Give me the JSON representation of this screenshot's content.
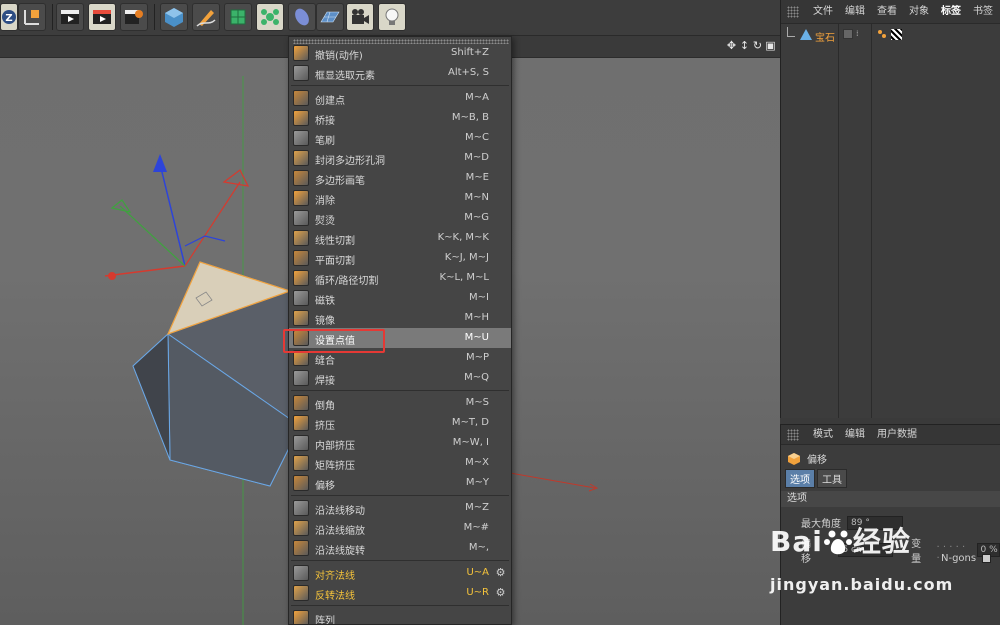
{
  "toolbar": {
    "buttons": [
      {
        "icon": "undo-z-icon"
      },
      {
        "icon": "coordinate-axis-icon"
      },
      {
        "icon": "render-view-icon"
      },
      {
        "icon": "render-picture-viewer-icon"
      },
      {
        "icon": "render-settings-icon"
      },
      {
        "icon": "cube-primitive-icon"
      },
      {
        "icon": "pen-spline-icon"
      },
      {
        "icon": "subdivision-surface-icon"
      },
      {
        "icon": "cloner-array-icon"
      },
      {
        "icon": "deformer-icon"
      },
      {
        "icon": "floor-plane-icon"
      },
      {
        "icon": "camera-icon"
      },
      {
        "icon": "light-bulb-icon"
      }
    ]
  },
  "object_manager": {
    "menu": [
      "文件",
      "编辑",
      "查看",
      "对象",
      "标签",
      "书签"
    ],
    "active_menu": "标签",
    "object_name": "宝石"
  },
  "attribute_manager": {
    "menu": [
      "模式",
      "编辑",
      "用户数据"
    ],
    "title": "偏移",
    "tabs": [
      "选项",
      "工具"
    ],
    "active_tab": "选项",
    "section": "选项",
    "fields": [
      {
        "label": "最大角度",
        "value": "89 °"
      },
      {
        "label": "偏移",
        "value": "5 cm"
      },
      {
        "label": "变量",
        "value": "0 %"
      }
    ],
    "ngons_label": "N-gons"
  },
  "context_menu": {
    "items": [
      {
        "label": "撤销(动作)",
        "shortcut": "Shift+Z",
        "icon": "undo-action-icon"
      },
      {
        "label": "框显选取元素",
        "shortcut": "Alt+S, S",
        "icon": "frame-selected-icon"
      },
      {
        "sep": true
      },
      {
        "label": "创建点",
        "shortcut": "M~A",
        "icon": "create-point-icon"
      },
      {
        "label": "桥接",
        "shortcut": "M~B, B",
        "icon": "bridge-icon"
      },
      {
        "label": "笔刷",
        "shortcut": "M~C",
        "icon": "brush-icon"
      },
      {
        "label": "封闭多边形孔洞",
        "shortcut": "M~D",
        "icon": "close-polygon-hole-icon"
      },
      {
        "label": "多边形画笔",
        "shortcut": "M~E",
        "icon": "polygon-pen-icon"
      },
      {
        "label": "消除",
        "shortcut": "M~N",
        "icon": "dissolve-icon"
      },
      {
        "label": "熨烫",
        "shortcut": "M~G",
        "icon": "iron-icon"
      },
      {
        "label": "线性切割",
        "shortcut": "K~K, M~K",
        "icon": "line-cut-icon"
      },
      {
        "label": "平面切割",
        "shortcut": "K~J, M~J",
        "icon": "plane-cut-icon"
      },
      {
        "label": "循环/路径切割",
        "shortcut": "K~L, M~L",
        "icon": "loop-path-cut-icon"
      },
      {
        "label": "磁铁",
        "shortcut": "M~I",
        "icon": "magnet-icon"
      },
      {
        "label": "镜像",
        "shortcut": "M~H",
        "icon": "mirror-icon"
      },
      {
        "label": "设置点值",
        "shortcut": "M~U",
        "icon": "set-point-value-icon",
        "highlighted": true
      },
      {
        "label": "缝合",
        "shortcut": "M~P",
        "icon": "stitch-sew-icon"
      },
      {
        "label": "焊接",
        "shortcut": "M~Q",
        "icon": "weld-icon"
      },
      {
        "sep": true
      },
      {
        "label": "倒角",
        "shortcut": "M~S",
        "icon": "bevel-icon"
      },
      {
        "label": "挤压",
        "shortcut": "M~T, D",
        "icon": "extrude-icon"
      },
      {
        "label": "内部挤压",
        "shortcut": "M~W, I",
        "icon": "extrude-inner-icon"
      },
      {
        "label": "矩阵挤压",
        "shortcut": "M~X",
        "icon": "matrix-extrude-icon"
      },
      {
        "label": "偏移",
        "shortcut": "M~Y",
        "icon": "offset-icon"
      },
      {
        "sep": true
      },
      {
        "label": "沿法线移动",
        "shortcut": "M~Z",
        "icon": "normal-move-icon"
      },
      {
        "label": "沿法线缩放",
        "shortcut": "M~#",
        "icon": "normal-scale-icon"
      },
      {
        "label": "沿法线旋转",
        "shortcut": "M~,",
        "icon": "normal-rotate-icon"
      },
      {
        "sep": true
      },
      {
        "label": "对齐法线",
        "shortcut": "U~A",
        "icon": "align-normals-icon",
        "yellow": true,
        "gear": true
      },
      {
        "label": "反转法线",
        "shortcut": "U~R",
        "icon": "reverse-normals-icon",
        "yellow": true,
        "gear": true
      },
      {
        "sep": true
      },
      {
        "label": "阵列",
        "shortcut": "",
        "icon": "array-icon"
      }
    ]
  },
  "watermark": {
    "brand_left": "Bai",
    "brand_right": "经验",
    "url": "jingyan.baidu.com"
  },
  "colors": {
    "menu_bg": "#454545",
    "menu_highlight": "#7a7a7a",
    "highlight_box": "#e53935",
    "accent_orange": "#f2a23c",
    "accent_yellow": "#f5c33b",
    "tab_active": "#5b7fa8"
  }
}
